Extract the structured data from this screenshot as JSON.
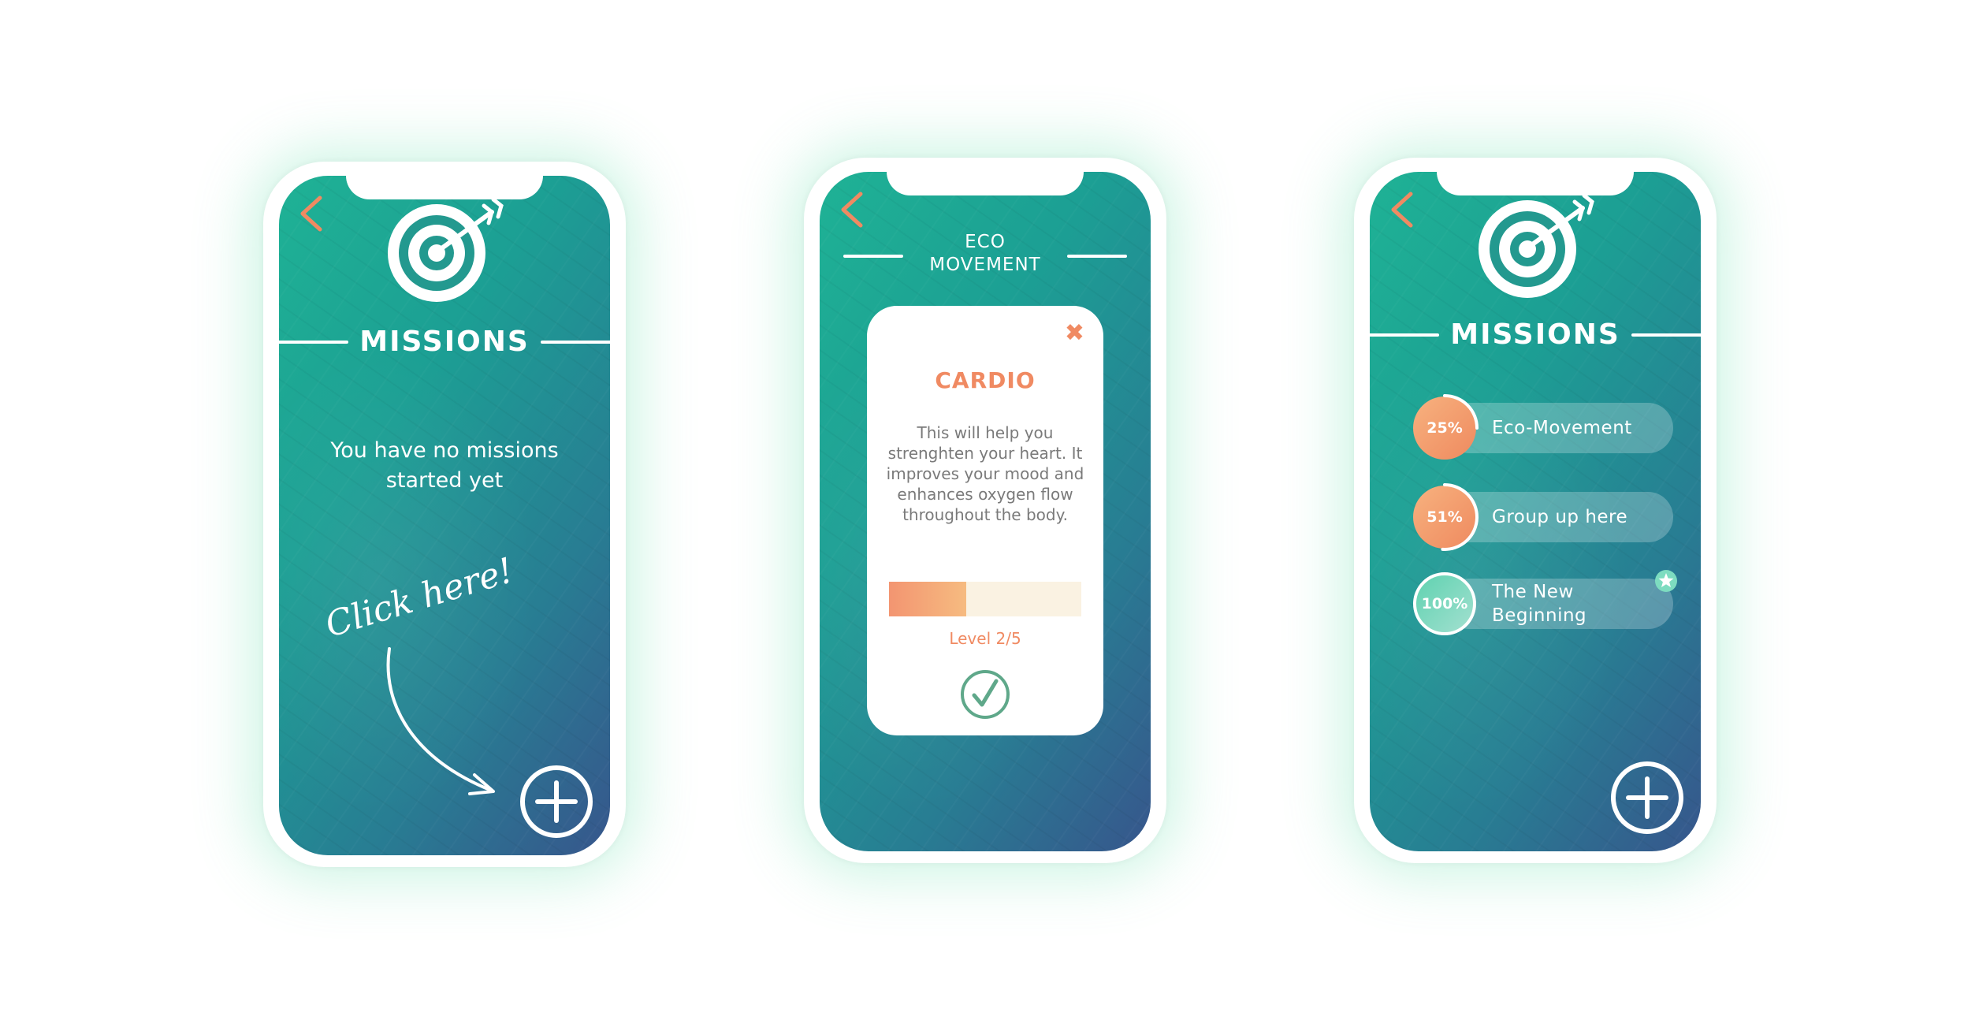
{
  "colors": {
    "accent": "#f08a62",
    "teal": "#1fb295",
    "navy": "#37568c",
    "white": "#ffffff",
    "success": "#5fa88a"
  },
  "phone1": {
    "back_icon": "chevron-left-icon",
    "target_icon": "target-arrow-icon",
    "title": "MISSIONS",
    "empty_message": "You have no missions\nstarted yet",
    "hint": "Click here!",
    "add_icon": "plus-circle-icon"
  },
  "phone2": {
    "back_icon": "chevron-left-icon",
    "title_line1": "ECO",
    "title_line2": "MOVEMENT",
    "card": {
      "close_icon": "close-icon",
      "close_glyph": "✖",
      "title": "CARDIO",
      "description": "This will help you strenghten your heart. It improves your mood and enhances oxygen flow throughout the body.",
      "level_label": "Level 2/5",
      "level_fraction": 0.4,
      "confirm_icon": "check-circle-icon"
    }
  },
  "phone3": {
    "back_icon": "chevron-left-icon",
    "target_icon": "target-arrow-icon",
    "title": "MISSIONS",
    "missions": [
      {
        "percent_label": "25%",
        "progress": 0.25,
        "name": "Eco-Movement",
        "style": "orange"
      },
      {
        "percent_label": "51%",
        "progress": 0.51,
        "name": "Group up here",
        "style": "orange"
      },
      {
        "percent_label": "100%",
        "progress": 1.0,
        "name": "The New\nBeginning",
        "style": "green",
        "badge_icon": "star-badge-icon"
      }
    ],
    "add_icon": "plus-circle-icon"
  }
}
